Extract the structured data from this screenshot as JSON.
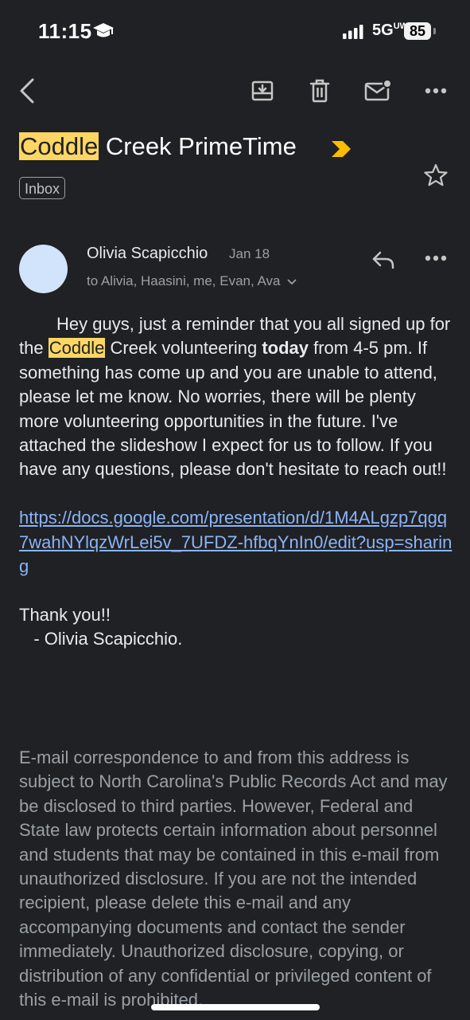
{
  "status_bar": {
    "time": "11:15",
    "network": "5G",
    "network_suffix": "UW",
    "battery": "85"
  },
  "toolbar": {
    "icons": [
      "back-arrow-icon",
      "archive-icon",
      "trash-icon",
      "mark-unread-icon",
      "more-icon"
    ]
  },
  "email": {
    "subject_highlight": "Coddle",
    "subject_rest": " Creek PrimeTime",
    "label": "Inbox",
    "sender_name": "Olivia Scapicchio",
    "date": "Jan 18",
    "recipients": "to Alivia, Haasini, me, Evan, Ava",
    "body": {
      "intro": "Hey guys, just a reminder that you all signed up for the ",
      "intro_highlight": "Coddle",
      "intro_cont": " Creek volunteering ",
      "intro_bold": "today",
      "intro_rest": " from 4-5 pm. If something has come up and you are unable to attend, please let me know. No worries, there will be plenty more volunteering opportunities in the future. I've attached the slideshow I expect for us to follow. If you have any questions, please don't hesitate to reach out!!",
      "link": "https://docs.google.com/presentation/d/1M4ALgzp7qgq7wahNYlqzWrLei5v_7UFDZ-hfbqYnIn0/edit?usp=sharing",
      "thanks": "Thank you!!",
      "signature": "   - Olivia Scapicchio."
    },
    "disclaimer": "E-mail correspondence to and from this address is subject to North Carolina's Public Records Act and may be disclosed to third parties. However, Federal and State law protects certain information about personnel and students that may be contained in this e-mail from unauthorized disclosure. If you are not the intended recipient, please delete this e-mail and any accompanying documents and contact the sender immediately. Unauthorized disclosure, copying, or distribution of any confidential or privileged content of this e-mail is prohibited."
  },
  "colors": {
    "background": "#202124",
    "highlight": "#fdd663",
    "link": "#8ab4f8",
    "importance_marker": "#fbbc04",
    "avatar": "#d2e3fc"
  }
}
